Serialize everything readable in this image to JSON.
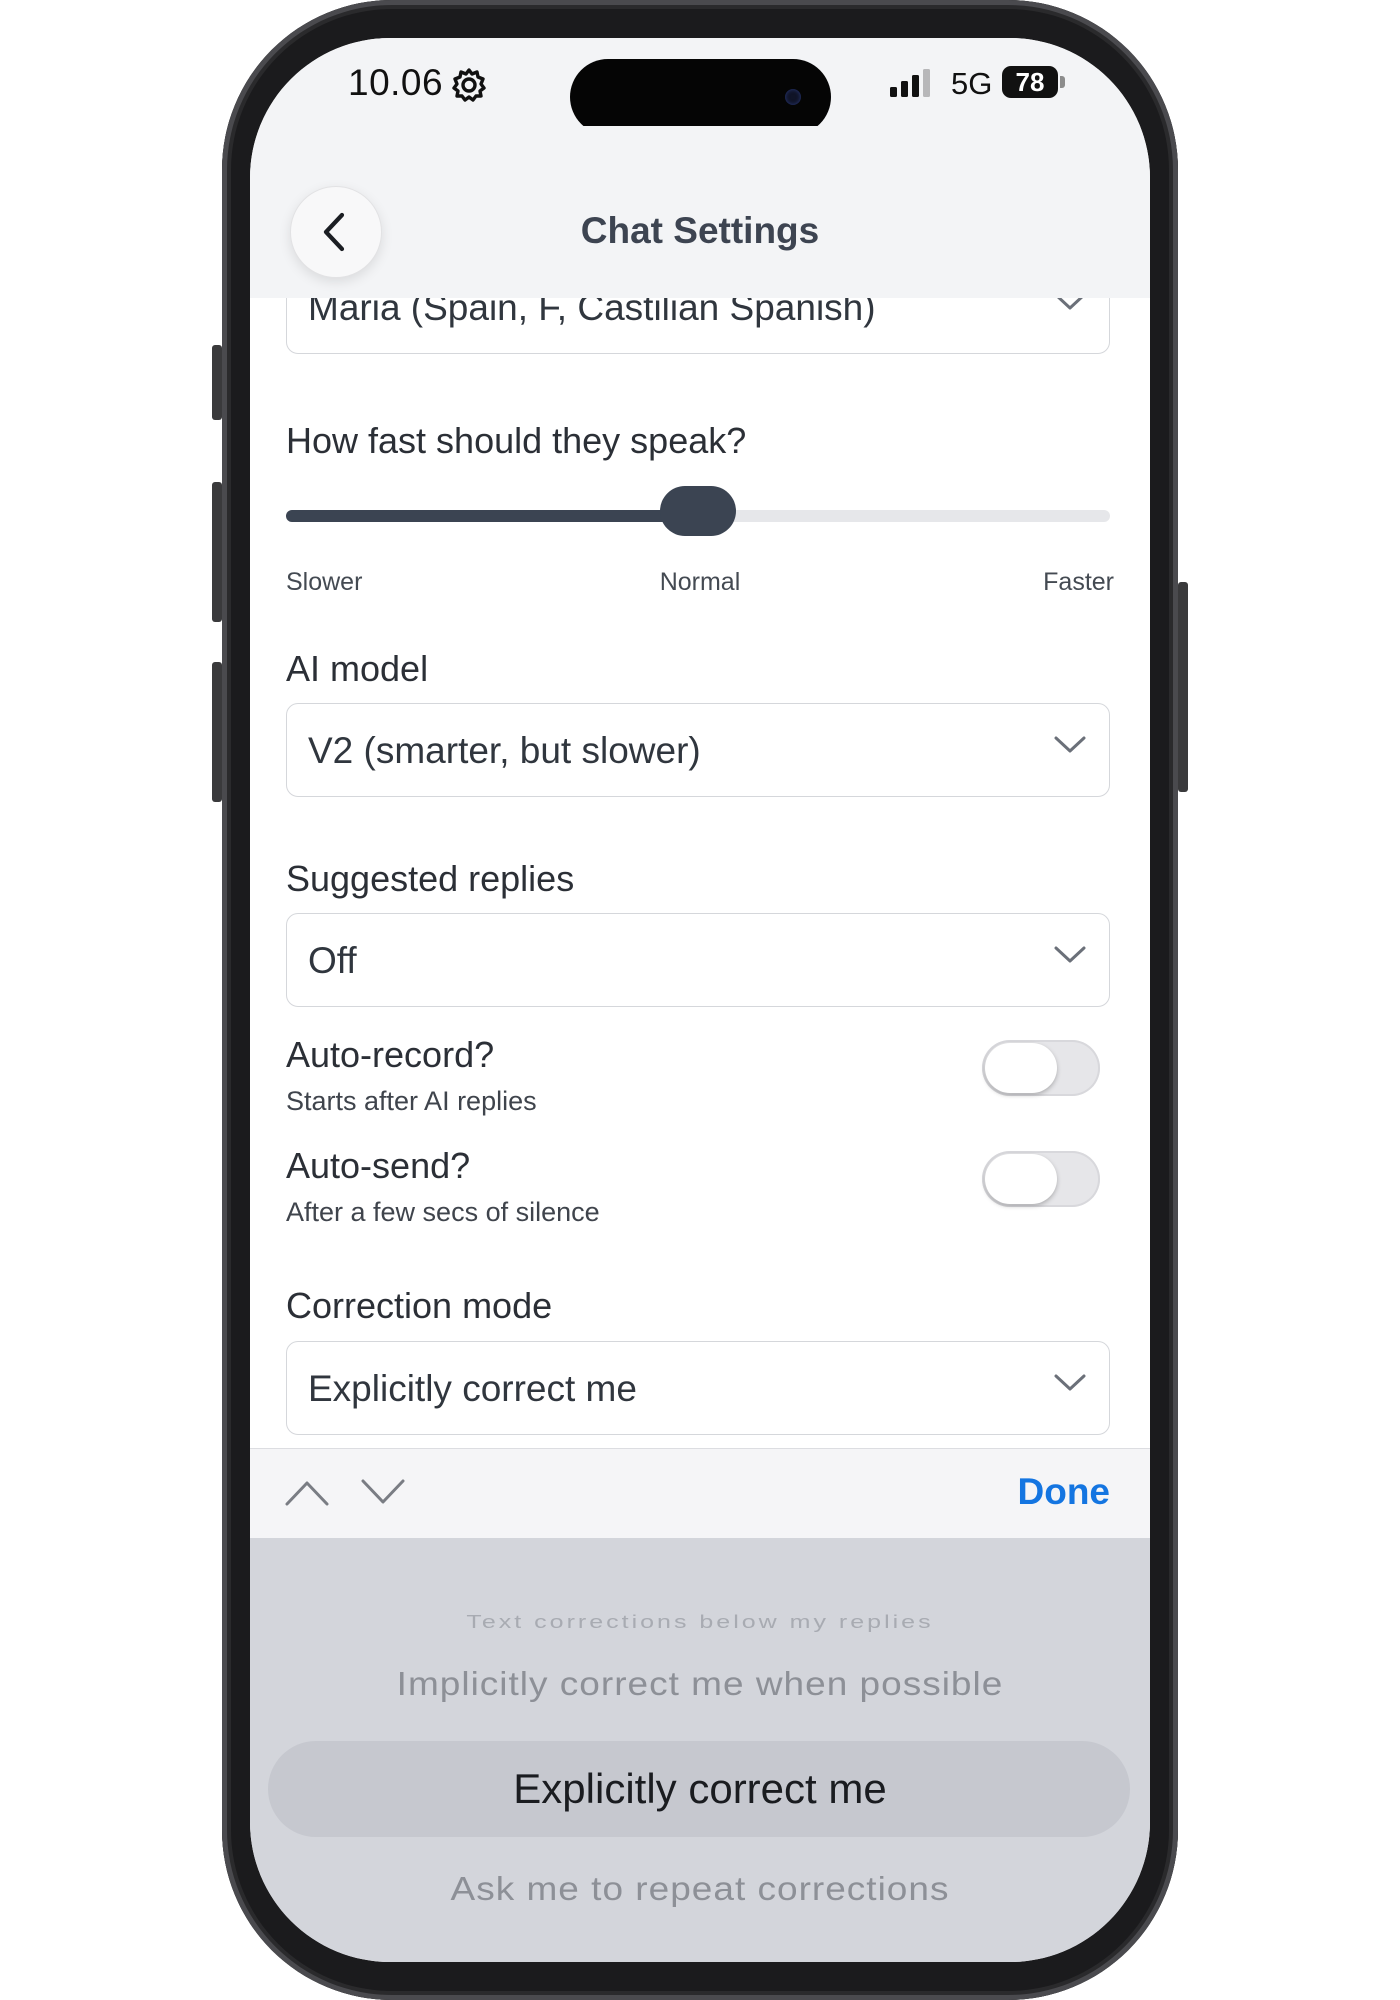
{
  "status_bar": {
    "time": "10.06",
    "network": "5G",
    "battery": "78"
  },
  "header": {
    "title": "Chat Settings"
  },
  "voice": {
    "value": "Maria (Spain, F, Castilian Spanish)"
  },
  "speed": {
    "label": "How fast should they speak?",
    "ticks": [
      "Slower",
      "Normal",
      "Faster"
    ],
    "value_fraction": 0.5
  },
  "ai_model": {
    "label": "AI model",
    "value": "V2 (smarter, but slower)"
  },
  "suggested_replies": {
    "label": "Suggested replies",
    "value": "Off"
  },
  "auto_record": {
    "label": "Auto-record?",
    "sub": "Starts after AI replies",
    "on": false
  },
  "auto_send": {
    "label": "Auto-send?",
    "sub": "After a few secs of silence",
    "on": false
  },
  "correction_mode": {
    "label": "Correction mode",
    "value": "Explicitly correct me"
  },
  "toolbar": {
    "done_label": "Done"
  },
  "picker": {
    "options": [
      "Text corrections below my replies",
      "Implicitly correct me when possible",
      "Explicitly correct me",
      "Ask me to repeat corrections"
    ],
    "selected_index": 2
  },
  "colors": {
    "accent": "#1475e1",
    "slider": "#3b4452",
    "picker_bg": "#d3d5db"
  }
}
